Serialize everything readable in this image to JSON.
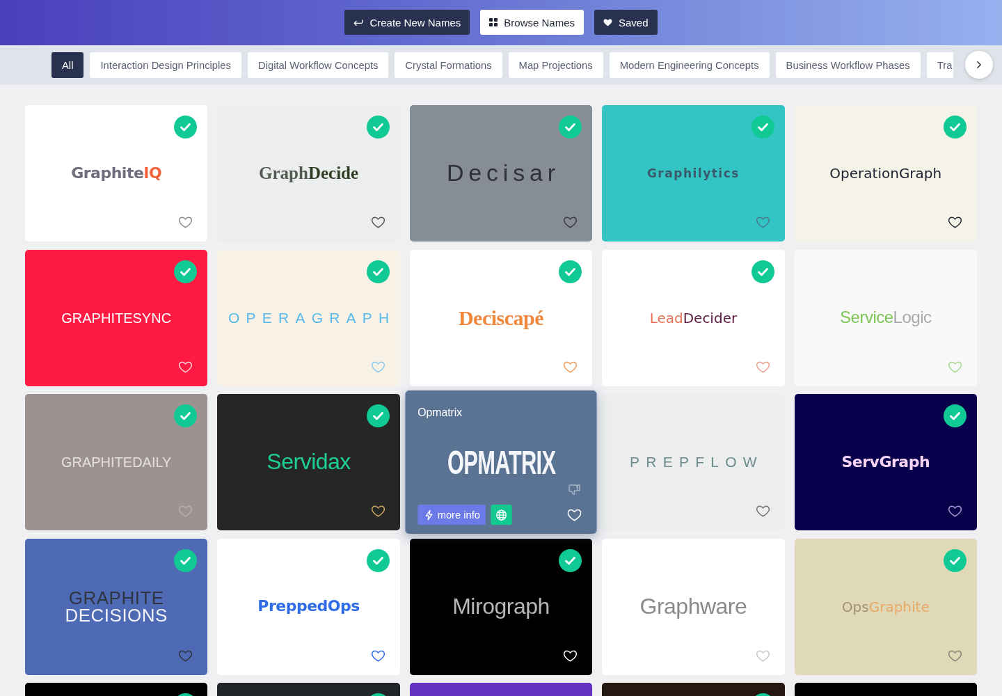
{
  "nav": [
    {
      "label": "Create New Names",
      "selected": false
    },
    {
      "label": "Browse Names",
      "selected": true
    },
    {
      "label": "Saved",
      "selected": false
    }
  ],
  "filters": [
    {
      "label": "All",
      "selected": true
    },
    {
      "label": "Interaction Design Principles",
      "selected": false
    },
    {
      "label": "Digital Workflow Concepts",
      "selected": false
    },
    {
      "label": "Crystal Formations",
      "selected": false
    },
    {
      "label": "Map Projections",
      "selected": false
    },
    {
      "label": "Modern Engineering Concepts",
      "selected": false
    },
    {
      "label": "Business Workflow Phases",
      "selected": false
    },
    {
      "label": "Tra",
      "selected": false
    }
  ],
  "cards": [
    {
      "color": "#ffffff",
      "kind": "bold",
      "logo": [
        {
          "text": "Graphite",
          "color": "#6e6e7c"
        },
        {
          "text": "IQ",
          "color": "#f2643c"
        }
      ],
      "checked": true,
      "hovered": false,
      "heart": {
        "color": "#8a8a90"
      }
    },
    {
      "color": "#eceeed",
      "kind": "serif",
      "logo": [
        {
          "text": "Graph",
          "color": "#545a52"
        },
        {
          "text": "Decide",
          "color": "#2f3d24"
        }
      ],
      "checked": true,
      "hovered": false,
      "heart": {
        "color": "#55585a"
      }
    },
    {
      "color": "#878d94",
      "kind": "spaced",
      "logo": [
        {
          "text": "Decisar",
          "color": "#2e3238"
        }
      ],
      "checked": true,
      "hovered": false,
      "heart": {
        "color": "#3a3e44"
      }
    },
    {
      "color": "#33c4c4",
      "kind": "tracked",
      "logo": [
        {
          "text": "Graphilytics",
          "color": "#3d5a6c"
        }
      ],
      "checked": true,
      "hovered": false,
      "heart": {
        "color": "#4a7c8c"
      }
    },
    {
      "color": "#f5f3e8",
      "kind": "rounded",
      "logo": [
        {
          "text": "OperationGraph",
          "color": "#1c2230"
        }
      ],
      "checked": true,
      "hovered": false,
      "heart": {
        "color": "#2a2e36"
      }
    },
    {
      "color": "#ff1a44",
      "kind": "caps",
      "logo": [
        {
          "text": "GRAPHITESYNC",
          "color": "#ffffff"
        }
      ],
      "checked": true,
      "hovered": false,
      "heart": {
        "color": "#ffd0d8"
      }
    },
    {
      "color": "#f8f2e6",
      "kind": "wide",
      "logo": [
        {
          "text": "OPERAGRAPH",
          "color": "#5ab8ea"
        }
      ],
      "checked": true,
      "hovered": false,
      "heart": {
        "color": "#8ccbee"
      }
    },
    {
      "color": "#ffffff",
      "kind": "display",
      "logo": [
        {
          "text": "Deciscapé",
          "color": "#f0883c"
        }
      ],
      "checked": true,
      "hovered": false,
      "heart": {
        "color": "#f2a060"
      }
    },
    {
      "color": "#ffffff",
      "kind": "rounded",
      "logo": [
        {
          "text": "Lead",
          "color": "#ea7258"
        },
        {
          "text": "Decider",
          "color": "#5c1a40"
        }
      ],
      "checked": true,
      "hovered": false,
      "heart": {
        "color": "#f0a090"
      }
    },
    {
      "color": "#f9f9fa",
      "kind": "light",
      "logo": [
        {
          "text": "Service",
          "color": "#7cc656"
        },
        {
          "text": "Logic",
          "color": "#a8a8ae"
        }
      ],
      "checked": false,
      "hovered": false,
      "heart": {
        "color": "#a8d890"
      }
    },
    {
      "color": "#9c9390",
      "kind": "caps",
      "logo": [
        {
          "text": "GRAPHITEDAILY",
          "color": "#e4e0dc"
        }
      ],
      "checked": true,
      "hovered": false,
      "heart": {
        "color": "#b8b0ac"
      }
    },
    {
      "color": "#262624",
      "kind": "thin",
      "logo": [
        {
          "text": "Servidax",
          "color": "#1fcf98"
        }
      ],
      "checked": true,
      "hovered": false,
      "heart": {
        "color": "#c8a860"
      }
    },
    {
      "color": "#5a7393",
      "kind": "condensed",
      "logo": [
        {
          "text": "OPMATRIX",
          "color": "#f4f6fa"
        }
      ],
      "checked": false,
      "hovered": true,
      "label": "Opmatrix",
      "more_info": "more info",
      "heart": {
        "color": "#ffffff"
      }
    },
    {
      "color": "#eceeed",
      "kind": "wide",
      "logo": [
        {
          "text": "PREPFLOW",
          "color": "#6a8c8c"
        }
      ],
      "checked": false,
      "hovered": false,
      "heart": {
        "color": "#707478"
      }
    },
    {
      "color": "#08004a",
      "kind": "bold",
      "logo": [
        {
          "text": "ServGraph",
          "color": "#f8d4f4"
        }
      ],
      "checked": true,
      "hovered": false,
      "heart": {
        "color": "#a498cc"
      }
    },
    {
      "color": "#4e6ab4",
      "kind": "stacked",
      "logo": [
        {
          "text": "GRAPHITE",
          "color": "#2e3440"
        },
        {
          "text": "DECISIONS",
          "color": "#f0f2f8"
        }
      ],
      "checked": true,
      "hovered": false,
      "heart": {
        "color": "#2e3440"
      }
    },
    {
      "color": "#ffffff",
      "kind": "bold",
      "logo": [
        {
          "text": "PreppedOps",
          "color": "#2f6ce6"
        }
      ],
      "checked": true,
      "hovered": false,
      "heart": {
        "color": "#2f6ce6"
      }
    },
    {
      "color": "#000000",
      "kind": "thin",
      "logo": [
        {
          "text": "Mirograph",
          "color": "#b8b8bc"
        }
      ],
      "checked": true,
      "hovered": false,
      "heart": {
        "color": "#ffffff"
      }
    },
    {
      "color": "#ffffff",
      "kind": "thin",
      "logo": [
        {
          "text": "Graphware",
          "color": "#8a8a8e"
        }
      ],
      "checked": false,
      "hovered": false,
      "heart": {
        "color": "#c8c8cc"
      }
    },
    {
      "color": "#e0d9b8",
      "kind": "rounded",
      "logo": [
        {
          "text": "Ops",
          "color": "#a09272"
        },
        {
          "text": "Graphite",
          "color": "#e8a866"
        }
      ],
      "checked": true,
      "hovered": false,
      "heart": {
        "color": "#8a8478"
      }
    },
    {
      "color": "#000000",
      "checked": true,
      "hovered": false
    },
    {
      "color": "#212429",
      "checked": true,
      "hovered": false
    },
    {
      "color": "#6232c0",
      "checked": false,
      "hovered": false
    },
    {
      "color": "#241810",
      "checked": true,
      "hovered": false
    },
    {
      "color": "#000000",
      "checked": false,
      "hovered": false
    }
  ]
}
